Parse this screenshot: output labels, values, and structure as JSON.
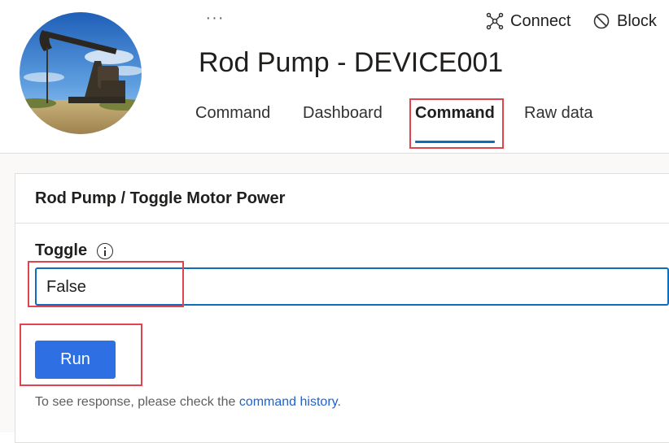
{
  "header": {
    "more_label": "···",
    "device_title": "Rod Pump - DEVICE001",
    "actions": [
      {
        "label": "Connect",
        "icon": "connect-icon"
      },
      {
        "label": "Block",
        "icon": "block-icon"
      }
    ],
    "tabs": [
      {
        "label": "Command",
        "active": false
      },
      {
        "label": "Dashboard",
        "active": false
      },
      {
        "label": "Command",
        "active": true
      },
      {
        "label": "Raw data",
        "active": false
      }
    ],
    "avatar_icon": "oil-pump-photo"
  },
  "command_panel": {
    "title": "Rod Pump / Toggle Motor Power",
    "field_label": "Toggle",
    "field_value": "False",
    "run_label": "Run",
    "helper_prefix": "To see response, please check the ",
    "helper_link": "command history",
    "helper_suffix": "."
  },
  "colors": {
    "accent": "#0f6cbd",
    "run_button": "#2f6fe4",
    "highlight": "#e0454f"
  }
}
